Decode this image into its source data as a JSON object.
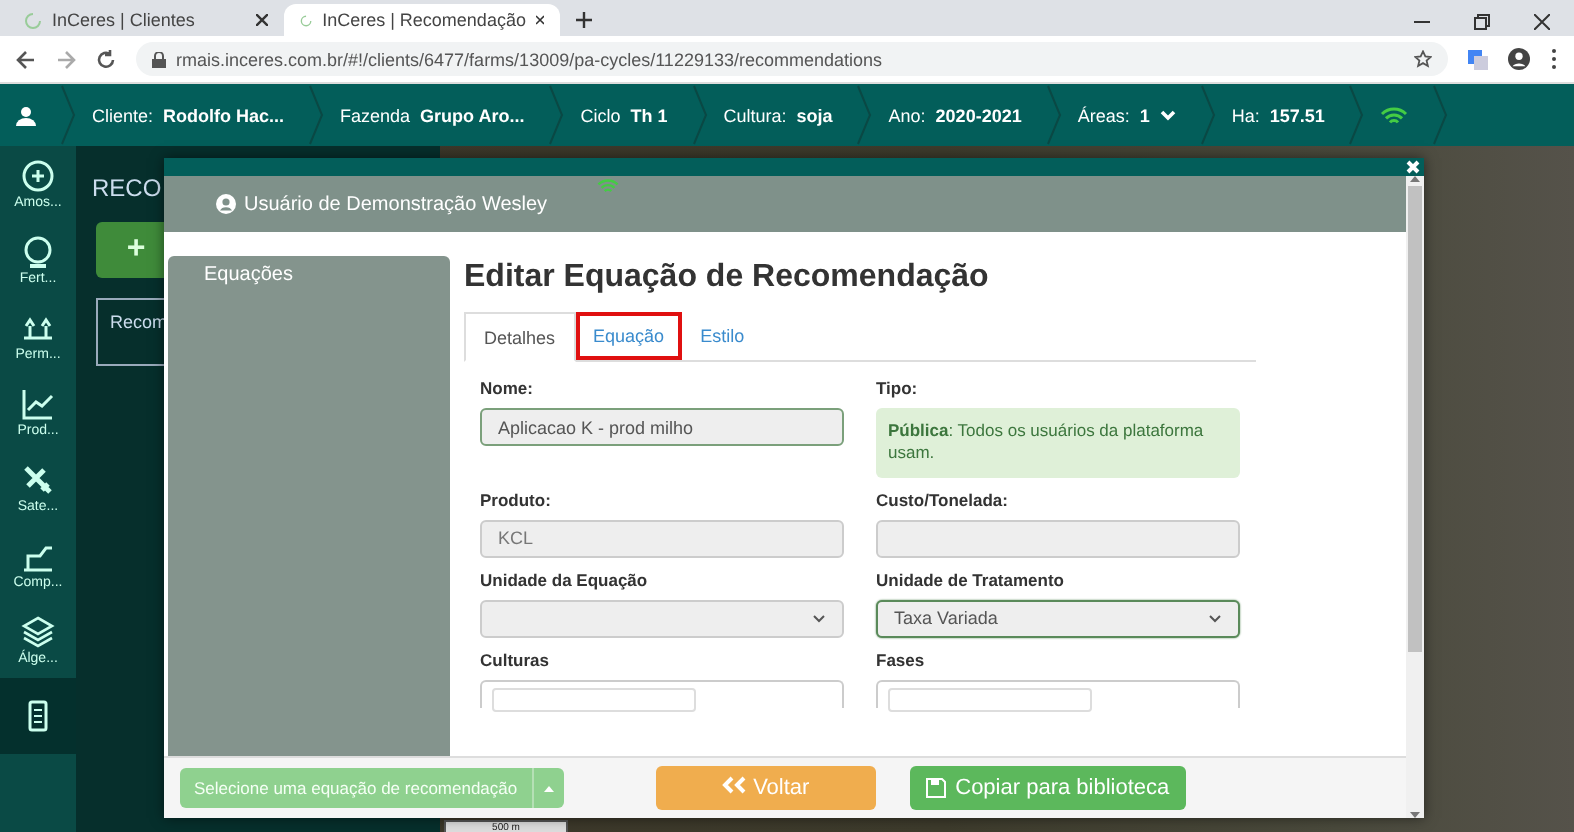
{
  "browser": {
    "tabs": [
      {
        "title": "InCeres | Clientes",
        "selected": false
      },
      {
        "title": "InCeres | Recomendação",
        "selected": true
      }
    ],
    "url": "rmais.inceres.com.br/#!/clients/6477/farms/13009/pa-cycles/11229133/recommendations"
  },
  "nav_bar": [
    {
      "label": "Cliente:",
      "value": "Rodolfo Hac..."
    },
    {
      "label": "Fazenda",
      "value": "Grupo Aro..."
    },
    {
      "label": "Ciclo",
      "value": "Th 1"
    },
    {
      "label": "Cultura:",
      "value": "soja"
    },
    {
      "label": "Ano:",
      "value": "2020-2021"
    },
    {
      "label": "Áreas:",
      "value": "1"
    },
    {
      "label": "Ha:",
      "value": "157.51"
    }
  ],
  "sidebar": {
    "items": [
      {
        "label": "Amos...",
        "selected": false
      },
      {
        "label": "Fert...",
        "selected": false
      },
      {
        "label": "Perm...",
        "selected": false
      },
      {
        "label": "Prod...",
        "selected": false
      },
      {
        "label": "Sate...",
        "selected": false
      },
      {
        "label": "Comp...",
        "selected": false
      },
      {
        "label": "Álge...",
        "selected": false
      },
      {
        "selected": true
      }
    ]
  },
  "panel": {
    "title": "RECO",
    "add_button": "+",
    "card": "Recom"
  },
  "map": {
    "scale": "500 m"
  },
  "modal": {
    "user": "Usuário de Demonstração Wesley",
    "side_title": "Equações",
    "title": "Editar Equação de Recomendação",
    "tabs": [
      {
        "label": "Detalhes",
        "selected": true,
        "highlighted": false
      },
      {
        "label": "Equação",
        "selected": false,
        "highlighted": true
      },
      {
        "label": "Estilo",
        "selected": false,
        "highlighted": false
      }
    ],
    "fields": [
      {
        "kind": "input",
        "label": "Nome:",
        "value": "Aplicacao K - prod milho",
        "disabled": false
      },
      {
        "kind": "alert",
        "label": "Tipo:",
        "value": "**Pública**: Todos os usuários da plataforma usam."
      },
      {
        "kind": "input",
        "label": "Produto:",
        "value": "KCL",
        "disabled": true
      },
      {
        "kind": "input",
        "label": "Custo/Tonelada:",
        "disabled": true
      },
      {
        "kind": "select",
        "label": "Unidade da Equação",
        "focused": false
      },
      {
        "kind": "select",
        "label": "Unidade de Tratamento",
        "value": "Taxa Variada",
        "focused": true
      },
      {
        "kind": "multi",
        "label": "Culturas"
      },
      {
        "kind": "multi",
        "label": "Fases"
      }
    ],
    "footer": {
      "select_button": "Selecione uma equação de recomendação",
      "back_button": "Voltar",
      "copy_button": "Copiar para biblioteca"
    }
  }
}
